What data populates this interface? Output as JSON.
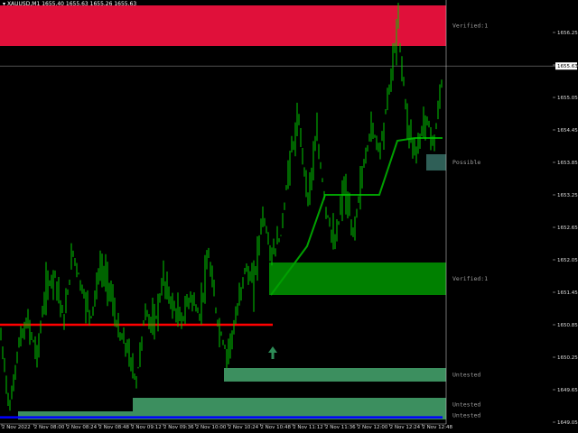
{
  "header": {
    "symbol_label": "XAUUSD,M1",
    "ohlc": "1655.40 1655.63 1655.26 1655.63"
  },
  "price_axis": {
    "ticks": [
      "1656.25",
      "1655.65",
      "1655.05",
      "1654.45",
      "1653.85",
      "1653.25",
      "1652.65",
      "1652.05",
      "1651.45",
      "1650.85",
      "1650.25",
      "1649.65",
      "1649.05"
    ],
    "current_price": "1655.63"
  },
  "time_axis": {
    "ticks": [
      "2 Nov 2022",
      "2 Nov 08:00",
      "2 Nov 08:24",
      "2 Nov 08:48",
      "2 Nov 09:12",
      "2 Nov 09:36",
      "2 Nov 10:00",
      "2 Nov 10:24",
      "2 Nov 10:48",
      "2 Nov 11:12",
      "2 Nov 11:36",
      "2 Nov 12:00",
      "2 Nov 12:24",
      "2 Nov 12:48"
    ]
  },
  "zones": [
    {
      "name": "supply-zone-verified-top",
      "label": "Verified:1",
      "color": "#e0103a",
      "price_top": 1656.75,
      "price_bottom": 1656.0
    },
    {
      "name": "supply-zone-possible",
      "label": "Possible",
      "color": "#2f5f57",
      "price_top": 1654.0,
      "price_bottom": 1653.7
    },
    {
      "name": "demand-zone-verified",
      "label": "Verified:1",
      "color": "#008000",
      "price_top": 1652.0,
      "price_bottom": 1651.4
    },
    {
      "name": "demand-zone-untested-1",
      "label": "Untested",
      "color": "#3c8f5f",
      "price_top": 1650.05,
      "price_bottom": 1649.8
    },
    {
      "name": "demand-zone-untested-2",
      "label": "Untested",
      "color": "#3c8f5f",
      "price_top": 1649.5,
      "price_bottom": 1649.25
    },
    {
      "name": "demand-zone-untested-3",
      "label": "Untested",
      "color": "#3c8f5f",
      "price_top": 1649.25,
      "price_bottom": 1649.1
    }
  ],
  "colors": {
    "candles": "#00c800",
    "red_line": "#ff0000",
    "blue_line": "#0000ff",
    "trend_line": "#00a000",
    "arrow": "#2e8b57",
    "grid_line": "#808080"
  },
  "chart_data": {
    "type": "line",
    "price_range": [
      1649.05,
      1656.75
    ],
    "series": [
      {
        "x_index": [
          0,
          10,
          20,
          30,
          40,
          50,
          60,
          70,
          80,
          90,
          100,
          110,
          120,
          130,
          140,
          150,
          160,
          170,
          180,
          190,
          200,
          210,
          220,
          230,
          240,
          250,
          260,
          270,
          280,
          290,
          300,
          310,
          320,
          330,
          340,
          350,
          360,
          370,
          380,
          390,
          400,
          410,
          420,
          430,
          440,
          450,
          460,
          470,
          480,
          490
        ],
        "values": [
          1650.6,
          1649.3,
          1650.5,
          1650.9,
          1650.3,
          1651.5,
          1651.8,
          1650.9,
          1652.2,
          1651.5,
          1651.0,
          1651.9,
          1651.6,
          1650.7,
          1650.4,
          1649.8,
          1651.1,
          1650.8,
          1651.7,
          1651.2,
          1650.9,
          1651.4,
          1651.0,
          1652.1,
          1650.9,
          1650.3,
          1650.9,
          1651.9,
          1651.6,
          1652.9,
          1652.1,
          1652.5,
          1653.9,
          1654.6,
          1653.2,
          1654.3,
          1653.0,
          1652.3,
          1653.4,
          1652.5,
          1653.6,
          1654.5,
          1654.1,
          1655.2,
          1656.4,
          1654.6,
          1654.0,
          1654.7,
          1654.2,
          1655.6
        ]
      }
    ],
    "red_line_price": 1650.85,
    "blue_line_price": 1649.14,
    "trend_line": {
      "x_index": [
        300,
        340,
        360,
        380,
        420,
        440,
        460,
        490
      ],
      "values": [
        1651.4,
        1652.3,
        1653.25,
        1653.25,
        1653.25,
        1654.25,
        1654.3,
        1654.3
      ]
    }
  }
}
